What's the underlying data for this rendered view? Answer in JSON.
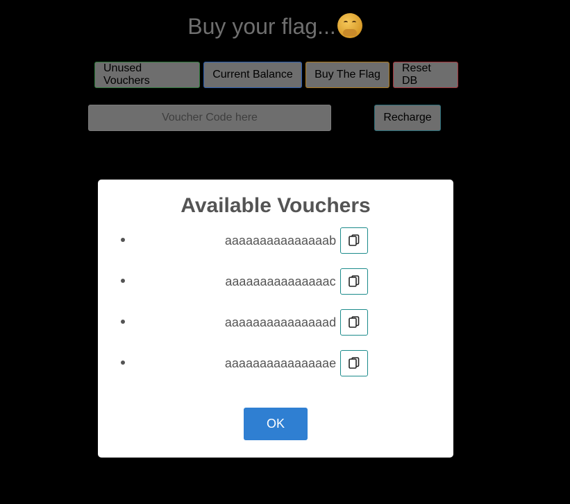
{
  "header": {
    "title": "Buy your flag...",
    "emoji_icon": "hand-over-mouth-emoji-icon"
  },
  "toolbar": {
    "unused_vouchers_label": "Unused Vouchers",
    "current_balance_label": "Current Balance",
    "buy_flag_label": "Buy The Flag",
    "reset_db_label": "Reset DB"
  },
  "recharge_form": {
    "voucher_placeholder": "Voucher Code here",
    "voucher_value": "",
    "recharge_label": "Recharge"
  },
  "modal": {
    "title": "Available Vouchers",
    "vouchers": [
      {
        "code": "aaaaaaaaaaaaaaab",
        "copy_icon": "copy-icon"
      },
      {
        "code": "aaaaaaaaaaaaaaac",
        "copy_icon": "copy-icon"
      },
      {
        "code": "aaaaaaaaaaaaaaad",
        "copy_icon": "copy-icon"
      },
      {
        "code": "aaaaaaaaaaaaaaae",
        "copy_icon": "copy-icon"
      }
    ],
    "ok_label": "OK"
  },
  "colors": {
    "background": "#000000",
    "ok_button": "#2f7fd2",
    "copy_button_border": "#1a8a8a"
  }
}
